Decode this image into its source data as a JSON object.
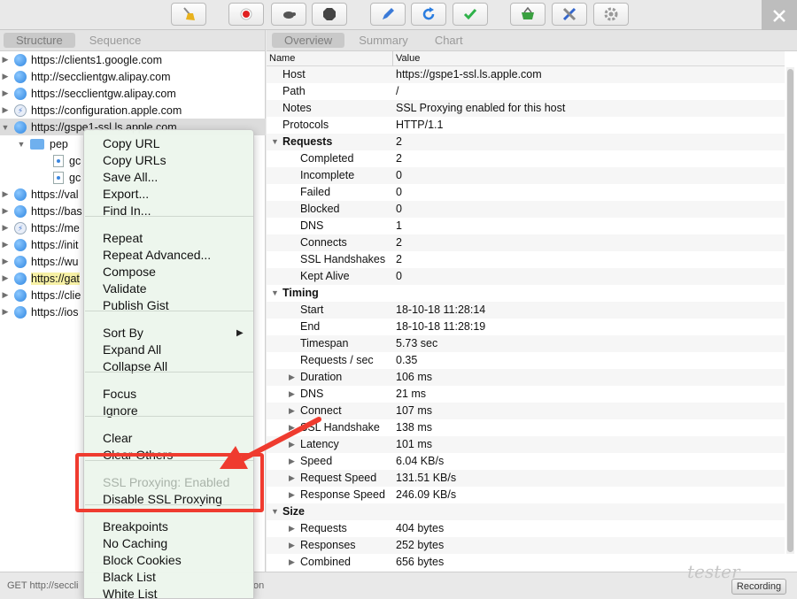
{
  "toolbar": {
    "buttons": [
      {
        "name": "broom-icon",
        "color": "#e8b21e"
      },
      {
        "name": "record-icon",
        "color": "#e02020"
      },
      {
        "name": "turtle-icon",
        "color": "#555555"
      },
      {
        "name": "stop-icon",
        "color": "#444444"
      },
      {
        "name": "pen-icon",
        "color": "#3a7ad8"
      },
      {
        "name": "refresh-icon",
        "color": "#2a7de0"
      },
      {
        "name": "check-icon",
        "color": "#2fb24a"
      },
      {
        "name": "basket-icon",
        "color": "#3aa040"
      },
      {
        "name": "tools-icon",
        "color": "#3366cc"
      },
      {
        "name": "gear-icon",
        "color": "#999999"
      }
    ]
  },
  "left": {
    "tabs": [
      "Structure",
      "Sequence"
    ],
    "tree": [
      {
        "text": "https://clients1.google.com",
        "icon": "globe"
      },
      {
        "text": "http://secclientgw.alipay.com",
        "icon": "globe"
      },
      {
        "text": "https://secclientgw.alipay.com",
        "icon": "globe"
      },
      {
        "text": "https://configuration.apple.com",
        "icon": "bolt"
      },
      {
        "text": "https://gspe1-ssl.ls.apple.com",
        "icon": "globe"
      },
      {
        "text": "pep",
        "icon": "folder"
      },
      {
        "text": "gc",
        "icon": "file"
      },
      {
        "text": "gc",
        "icon": "file"
      },
      {
        "text": "https://val",
        "icon": "globe"
      },
      {
        "text": "https://bas",
        "icon": "globe"
      },
      {
        "text": "https://me",
        "icon": "bolt"
      },
      {
        "text": "https://init",
        "icon": "globe"
      },
      {
        "text": "https://wu",
        "icon": "globe"
      },
      {
        "text": "https://gat",
        "icon": "globe"
      },
      {
        "text": "https://clie",
        "icon": "globe"
      },
      {
        "text": "https://ios",
        "icon": "globe"
      }
    ]
  },
  "status": {
    "text": "GET http://seccli",
    "tail": "on",
    "recording": "Recording",
    "watermark": "tester"
  },
  "right": {
    "tabs": [
      "Overview",
      "Summary",
      "Chart"
    ],
    "columns": [
      "Name",
      "Value"
    ],
    "rows": [
      {
        "k": "Host",
        "v": "https://gspe1-ssl.ls.apple.com"
      },
      {
        "k": "Path",
        "v": "/"
      },
      {
        "k": "Notes",
        "v": "SSL Proxying enabled for this host"
      },
      {
        "k": "Protocols",
        "v": "HTTP/1.1"
      },
      {
        "k": "Requests",
        "v": "2"
      },
      {
        "k": "Completed",
        "v": "2"
      },
      {
        "k": "Incomplete",
        "v": "0"
      },
      {
        "k": "Failed",
        "v": "0"
      },
      {
        "k": "Blocked",
        "v": "0"
      },
      {
        "k": "DNS",
        "v": "1"
      },
      {
        "k": "Connects",
        "v": "2"
      },
      {
        "k": "SSL Handshakes",
        "v": "2"
      },
      {
        "k": "Kept Alive",
        "v": "0"
      },
      {
        "k": "Timing",
        "v": ""
      },
      {
        "k": "Start",
        "v": "18-10-18 11:28:14"
      },
      {
        "k": "End",
        "v": "18-10-18 11:28:19"
      },
      {
        "k": "Timespan",
        "v": "5.73 sec"
      },
      {
        "k": "Requests / sec",
        "v": "0.35"
      },
      {
        "k": "Duration",
        "v": "106 ms"
      },
      {
        "k": "DNS",
        "v": "21 ms"
      },
      {
        "k": "Connect",
        "v": "107 ms"
      },
      {
        "k": "SSL Handshake",
        "v": "138 ms"
      },
      {
        "k": "Latency",
        "v": "101 ms"
      },
      {
        "k": "Speed",
        "v": "6.04 KB/s"
      },
      {
        "k": "Request Speed",
        "v": "131.51 KB/s"
      },
      {
        "k": "Response Speed",
        "v": "246.09 KB/s"
      },
      {
        "k": "Size",
        "v": ""
      },
      {
        "k": "Requests",
        "v": "404 bytes"
      },
      {
        "k": "Responses",
        "v": "252 bytes"
      },
      {
        "k": "Combined",
        "v": "656 bytes"
      }
    ]
  },
  "menu": {
    "items": [
      "Copy URL",
      "Copy URLs",
      "Save All...",
      "Export...",
      "Find In...",
      "Repeat",
      "Repeat Advanced...",
      "Compose",
      "Validate",
      "Publish Gist",
      "Sort By",
      "Expand All",
      "Collapse All",
      "Focus",
      "Ignore",
      "Clear",
      "Clear Others",
      "SSL Proxying: Enabled",
      "Disable SSL Proxying",
      "Breakpoints",
      "No Caching",
      "Block Cookies",
      "Black List",
      "White List"
    ]
  },
  "annotation": {
    "color": "#ef3b2f"
  }
}
